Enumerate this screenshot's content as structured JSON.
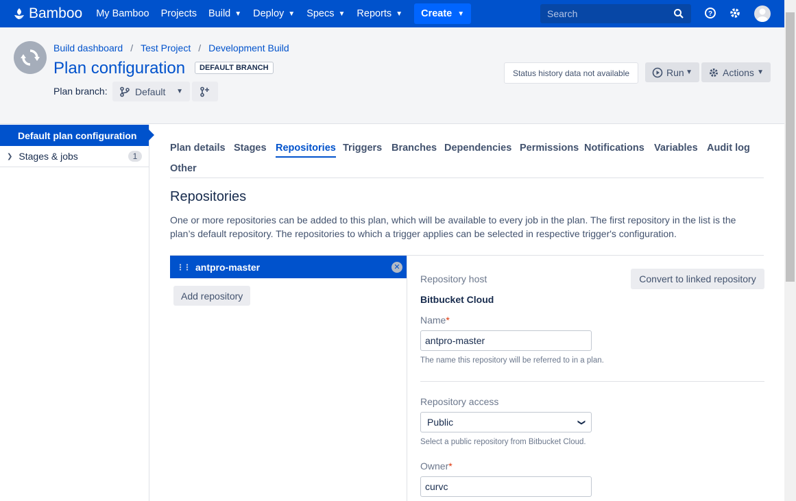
{
  "nav": {
    "brand": "Bamboo",
    "items": [
      {
        "label": "My Bamboo",
        "dropdown": false
      },
      {
        "label": "Projects",
        "dropdown": false
      },
      {
        "label": "Build",
        "dropdown": true
      },
      {
        "label": "Deploy",
        "dropdown": true
      },
      {
        "label": "Specs",
        "dropdown": true
      },
      {
        "label": "Reports",
        "dropdown": true
      }
    ],
    "create_label": "Create",
    "search_placeholder": "Search"
  },
  "header": {
    "breadcrumb": [
      "Build dashboard",
      "Test Project",
      "Development Build"
    ],
    "title": "Plan configuration",
    "lozenge": "DEFAULT BRANCH",
    "branch_label": "Plan branch:",
    "branch_value": "Default",
    "status": "Status history data not available",
    "run_label": "Run",
    "actions_label": "Actions"
  },
  "sidebar": {
    "active": "Default plan configuration",
    "items": [
      {
        "label": "Stages & jobs",
        "count": "1"
      }
    ]
  },
  "tabs": {
    "plan_details": "Plan details",
    "stages": "Stages",
    "repositories": "Repositories",
    "triggers": "Triggers",
    "branches": "Branches",
    "dependencies": "Dependencies",
    "permissions": "Permissions",
    "notifications": "Notifications",
    "variables": "Variables",
    "audit_log": "Audit log",
    "other": "Other",
    "active": "Repositories"
  },
  "main": {
    "title": "Repositories",
    "description": "One or more repositories can be added to this plan, which will be available to every job in the plan. The first repository in the list is the plan’s default repository. The repositories to which a trigger applies can be selected in respective trigger's configuration.",
    "repo_item": "antpro-master",
    "add_repo": "Add repository"
  },
  "panel": {
    "convert_label": "Convert to linked repository",
    "host_label": "Repository host",
    "host_value": "Bitbucket Cloud",
    "name_label": "Name",
    "name_value": "antpro-master",
    "name_help": "The name this repository will be referred to in a plan.",
    "access_label": "Repository access",
    "access_value": "Public",
    "access_help": "Select a public repository from Bitbucket Cloud.",
    "owner_label": "Owner",
    "owner_value": "curvc",
    "required_mark": "*"
  },
  "colors": {
    "primary": "#0052cc",
    "header_bg": "#f4f5f7",
    "required": "#de350b"
  }
}
